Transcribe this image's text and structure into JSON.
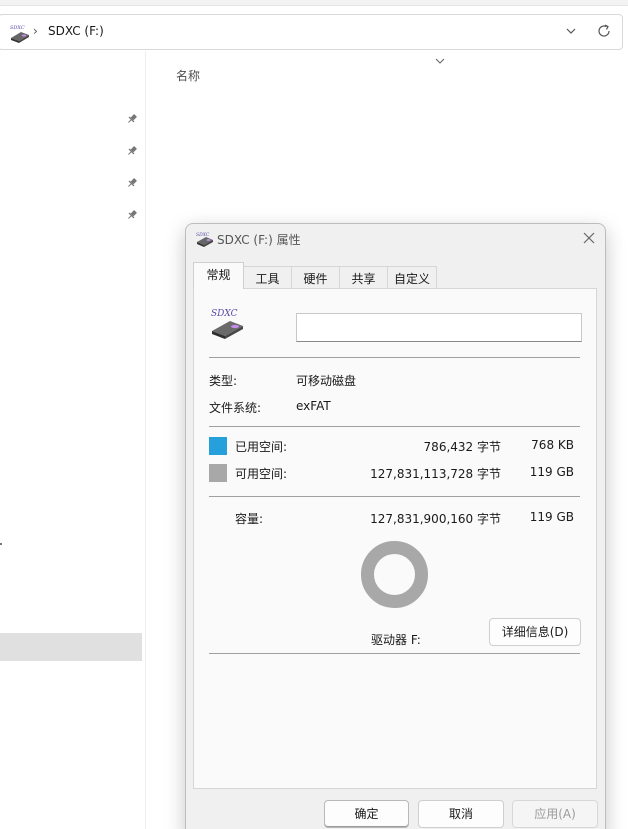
{
  "explorer": {
    "address": {
      "separator": "›",
      "path": "SDXC (F:)",
      "drive_icon": "sd-card-drive-icon",
      "dropdown_icon": "chevron-down-icon",
      "refresh_icon": "refresh-icon"
    },
    "nav": {
      "pin_icon": "pin-icon",
      "pinned_count": 4
    },
    "column_header": {
      "name": "名称",
      "sort_icon": "chevron-down-icon"
    }
  },
  "dialog": {
    "title": "SDXC (F:) 属性",
    "close_icon": "close-icon",
    "tabs": [
      {
        "label": "常规",
        "active": true
      },
      {
        "label": "工具",
        "active": false
      },
      {
        "label": "硬件",
        "active": false
      },
      {
        "label": "共享",
        "active": false
      },
      {
        "label": "自定义",
        "active": false
      }
    ],
    "drive_icon_label": "SDXC",
    "volume_name_value": "",
    "type_label": "类型:",
    "type_value": "可移动磁盘",
    "fs_label": "文件系统:",
    "fs_value": "exFAT",
    "used": {
      "label": "已用空间:",
      "bytes": "786,432 字节",
      "size": "768 KB",
      "color": "#26a0da"
    },
    "free": {
      "label": "可用空间:",
      "bytes": "127,831,113,728 字节",
      "size": "119 GB",
      "color": "#a8a8a8"
    },
    "capacity": {
      "label": "容量:",
      "bytes": "127,831,900,160 字节",
      "size": "119 GB"
    },
    "drive_label": "驱动器 F:",
    "used_fraction": 6.2e-06,
    "details_button": "详细信息(D)",
    "ok_button": "确定",
    "cancel_button": "取消",
    "apply_button": "应用(A)"
  }
}
